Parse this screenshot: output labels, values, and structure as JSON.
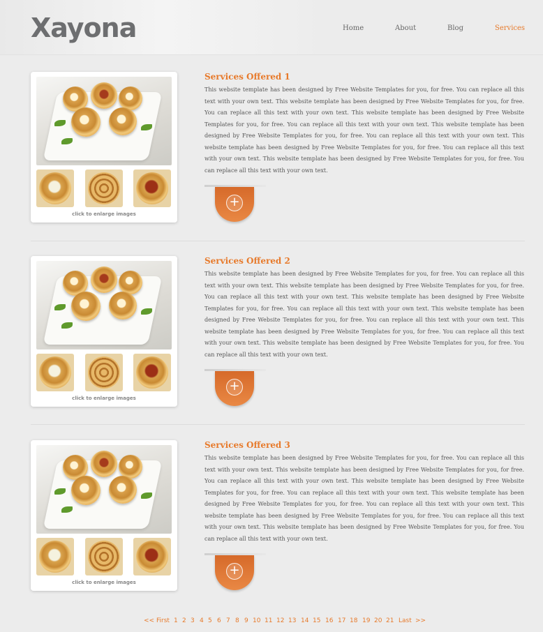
{
  "site": {
    "logo": "Xayona"
  },
  "nav": [
    {
      "label": "Home",
      "active": false
    },
    {
      "label": "About",
      "active": false
    },
    {
      "label": "Blog",
      "active": false
    },
    {
      "label": "Services",
      "active": true
    }
  ],
  "services": [
    {
      "title": "Services Offered 1",
      "body": "This website template has been designed by Free Website Templates for you, for free. You can replace all this text with your own text. This website template has been designed by Free Website Templates for you, for free. You can replace all this text with your own text. This website template has been designed by Free Website Templates for you, for free. You can replace all this text with your own text. This website template has been designed by Free Website Templates for you, for free. You can replace all this text with your own text. This website template has been designed by Free Website Templates for you, for free. You can replace all this text with your own text. This website template has been designed by Free Website Templates for you, for free. You can replace all this text with your own text.",
      "caption": "click to enlarge images"
    },
    {
      "title": "Services Offered 2",
      "body": "This website template has been designed by Free Website Templates for you, for free. You can replace all this text with your own text. This website template has been designed by Free Website Templates for you, for free. You can replace all this text with your own text. This website template has been designed by Free Website Templates for you, for free. You can replace all this text with your own text. This website template has been designed by Free Website Templates for you, for free. You can replace all this text with your own text. This website template has been designed by Free Website Templates for you, for free. You can replace all this text with your own text. This website template has been designed by Free Website Templates for you, for free. You can replace all this text with your own text.",
      "caption": "click to enlarge images"
    },
    {
      "title": "Services Offered 3",
      "body": "This website template has been designed by Free Website Templates for you, for free. You can replace all this text with your own text. This website template has been designed by Free Website Templates for you, for free. You can replace all this text with your own text. This website template has been designed by Free Website Templates for you, for free. You can replace all this text with your own text. This website template has been designed by Free Website Templates for you, for free. You can replace all this text with your own text. This website template has been designed by Free Website Templates for you, for free. You can replace all this text with your own text. This website template has been designed by Free Website Templates for you, for free. You can replace all this text with your own text.",
      "caption": "click to enlarge images"
    }
  ],
  "pager": [
    "<<",
    "First",
    "1",
    "2",
    "3",
    "4",
    "5",
    "6",
    "7",
    "8",
    "9",
    "10",
    "11",
    "12",
    "13",
    "14",
    "15",
    "16",
    "17",
    "18",
    "19",
    "20",
    "21",
    "Last",
    ">>"
  ],
  "colors": {
    "accent": "#e77a2b",
    "text": "#555555",
    "background": "#ececec"
  },
  "icons": {
    "expand": "plus-circle-icon"
  }
}
